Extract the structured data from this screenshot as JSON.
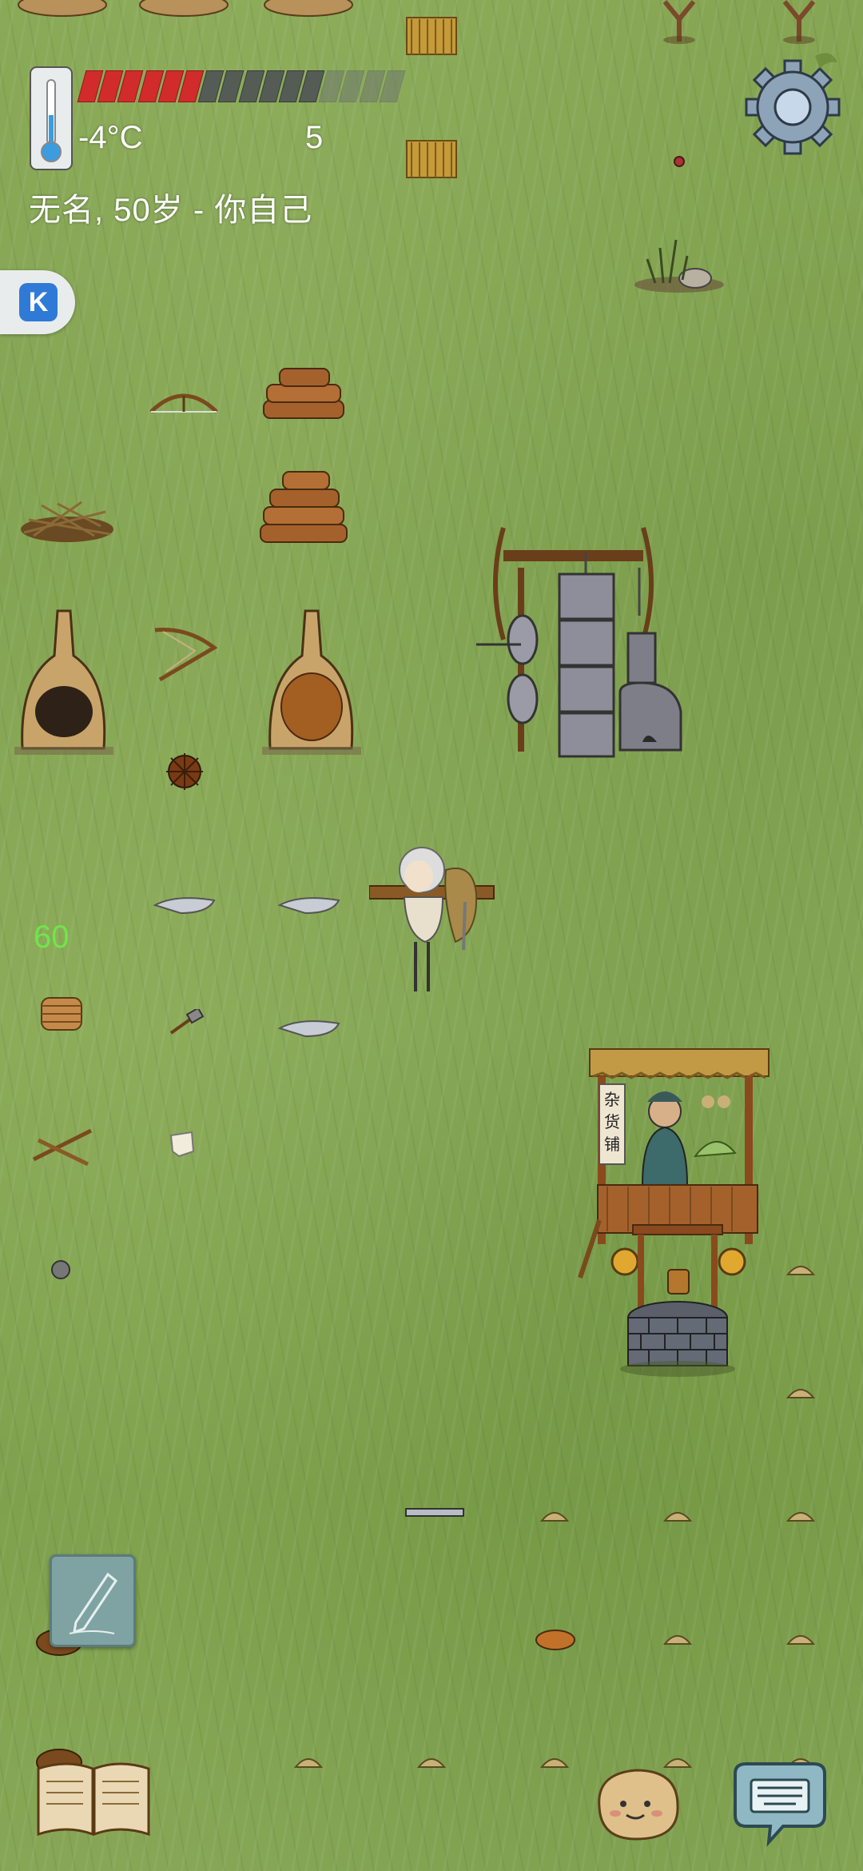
{
  "hud": {
    "temperature": "-4°C",
    "counter": "5",
    "identity": "无名, 50岁 - 你自己",
    "age_counter": "60",
    "food_pips_total": 12,
    "food_pips_filled": 6,
    "food_pips_extra": 4
  },
  "icons": {
    "thermometer": "thermometer-icon",
    "settings": "gear-icon",
    "side_app": "k-app-icon",
    "note": "pencil-icon",
    "recipe_book": "book-icon",
    "emote": "potato-face-icon",
    "chat": "keyboard-chat-icon"
  },
  "world": {
    "shop_sign": "杂货铺"
  },
  "colors": {
    "food_full": "#d22b2b",
    "food_empty": "#555c55",
    "age_counter": "#6fe64a"
  }
}
